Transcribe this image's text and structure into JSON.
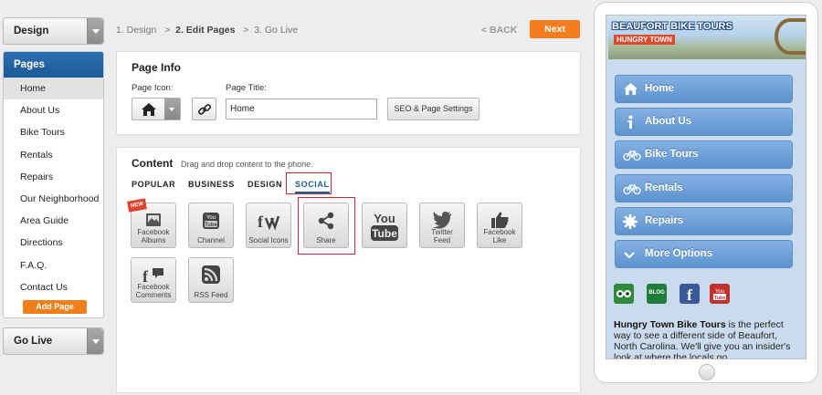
{
  "sidebar": {
    "design_label": "Design",
    "pages_title": "Pages",
    "pages": [
      "Home",
      "About Us",
      "Bike Tours",
      "Rentals",
      "Repairs",
      "Our Neighborhood",
      "Area Guide",
      "Directions",
      "F.A.Q.",
      "Contact Us"
    ],
    "active_page": "Home",
    "add_page_label": "Add Page",
    "go_live_label": "Go Live"
  },
  "steps": {
    "step1": "1. Design",
    "sep1": ">",
    "step2": "2. Edit Pages",
    "sep2": ">",
    "step3": "3. Go Live",
    "back_label": "< BACK",
    "next_label": "Next"
  },
  "page_info": {
    "title": "Page Info",
    "icon_label": "Page Icon:",
    "selected_icon": "home-icon",
    "title_label": "Page Title:",
    "title_value": "Home",
    "seo_label": "SEO & Page Settings"
  },
  "content": {
    "title": "Content",
    "hint": "Drag and drop content to the phone.",
    "tabs": [
      "POPULAR",
      "BUSINESS",
      "DESIGN",
      "SOCIAL"
    ],
    "active_tab": "SOCIAL",
    "new_badge": "NEW",
    "tiles": [
      {
        "label_lines": [
          "Facebook",
          "Albums"
        ],
        "icon": "facebook-albums-icon"
      },
      {
        "label_lines": [
          "Channel"
        ],
        "icon": "youtube-channel-icon"
      },
      {
        "label_lines": [
          "Social Icons"
        ],
        "icon": "social-icons-icon"
      },
      {
        "label_lines": [
          "Share"
        ],
        "icon": "share-icon"
      },
      {
        "label_lines": [],
        "icon": "youtube-icon"
      },
      {
        "label_lines": [
          "Twitter",
          "Feed"
        ],
        "icon": "twitter-icon"
      },
      {
        "label_lines": [
          "Facebook",
          "Like"
        ],
        "icon": "thumbs-up-icon"
      },
      {
        "label_lines": [
          "Facebook",
          "Comments"
        ],
        "icon": "facebook-comments-icon"
      },
      {
        "label_lines": [
          "RSS Feed"
        ],
        "icon": "rss-icon"
      }
    ]
  },
  "phone": {
    "banner_title": "BEAUFORT BIKE TOURS",
    "banner_sub": "HUNGRY TOWN",
    "nav": [
      {
        "label": "Home",
        "icon": "home-icon"
      },
      {
        "label": "About Us",
        "icon": "info-icon"
      },
      {
        "label": "Bike Tours",
        "icon": "bicycle-icon"
      },
      {
        "label": "Rentals",
        "icon": "bicycle-icon"
      },
      {
        "label": "Repairs",
        "icon": "gear-icon"
      },
      {
        "label": "More Options",
        "icon": "chevron-down-icon"
      }
    ],
    "social": [
      {
        "icon": "tripadvisor-icon",
        "color": "#2f8a3c"
      },
      {
        "icon": "blog-icon",
        "color": "#1e7d3b"
      },
      {
        "icon": "facebook-icon",
        "color": "#3b5998"
      },
      {
        "icon": "youtube-icon",
        "color": "#c4302b"
      }
    ],
    "blog_text": "BLOG",
    "intro_bold": "Hungry Town Bike Tours",
    "intro_rest": " is the perfect way to see a different side of Beaufort, North Carolina. We'll give you an insider's look at where the locals go"
  }
}
